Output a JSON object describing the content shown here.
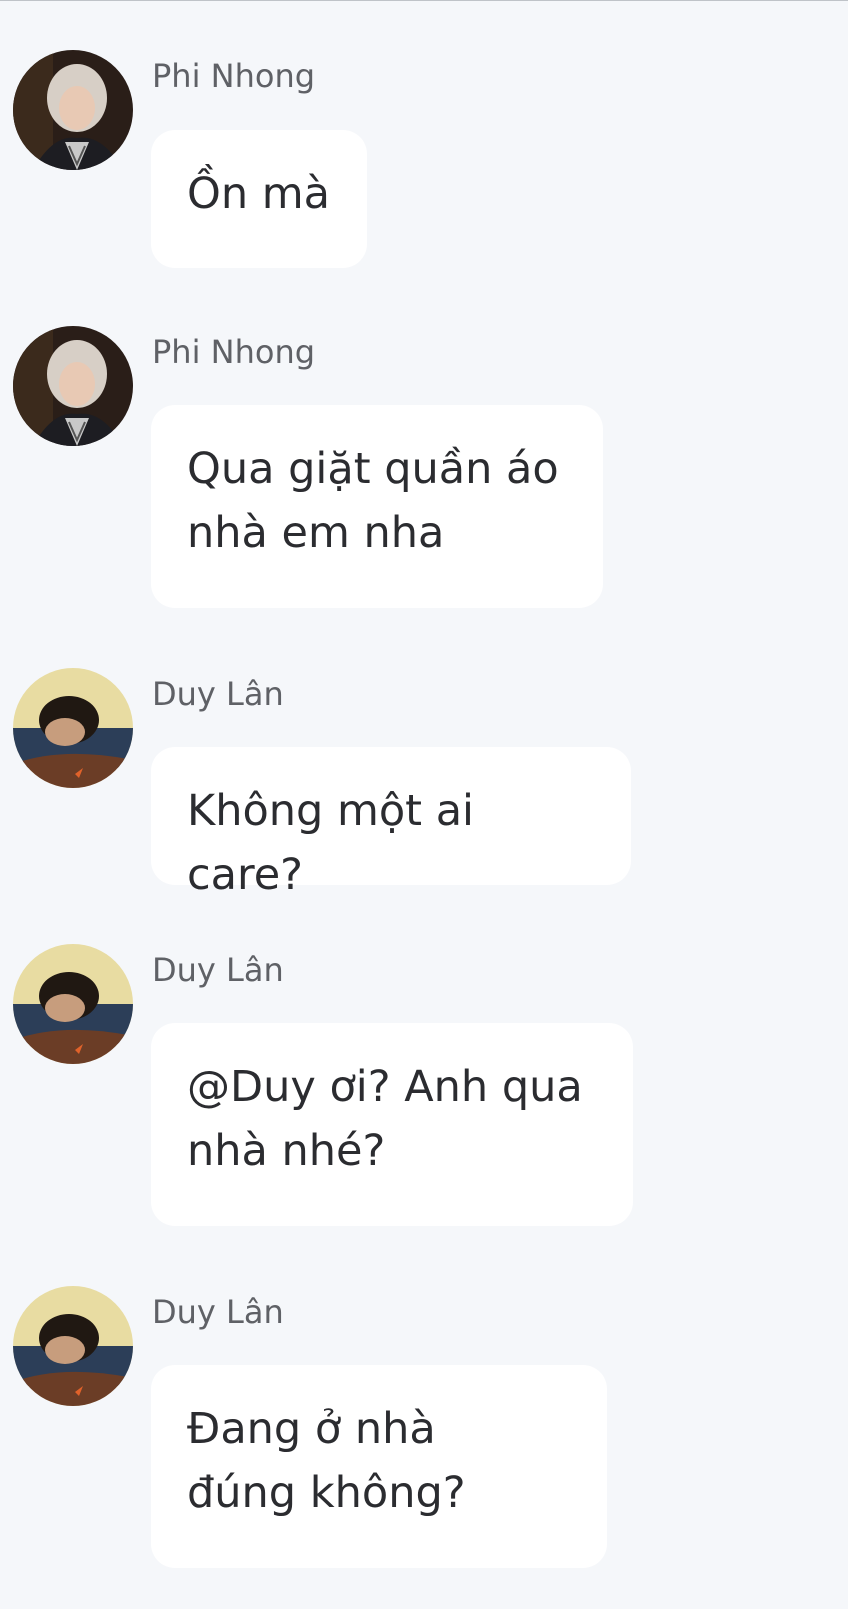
{
  "messages": [
    {
      "sender": "Phi Nhong",
      "avatar_icon": "phi-nhong-avatar",
      "text": "Ồn mà"
    },
    {
      "sender": "Phi Nhong",
      "avatar_icon": "phi-nhong-avatar",
      "text": "Qua giặt quần áo\nnhà em nha"
    },
    {
      "sender": "Duy Lân",
      "avatar_icon": "duy-lan-avatar",
      "text": "Không một ai care?"
    },
    {
      "sender": "Duy Lân",
      "avatar_icon": "duy-lan-avatar",
      "text": "@Duy ơi? Anh qua\nnhà nhé?"
    },
    {
      "sender": "Duy Lân",
      "avatar_icon": "duy-lan-avatar",
      "text": "Đang ở nhà\nđúng không?"
    }
  ],
  "colors": {
    "background": "#f5f7fa",
    "bubble": "#ffffff",
    "sender_text": "#5f6166",
    "message_text": "#2b2c30"
  }
}
